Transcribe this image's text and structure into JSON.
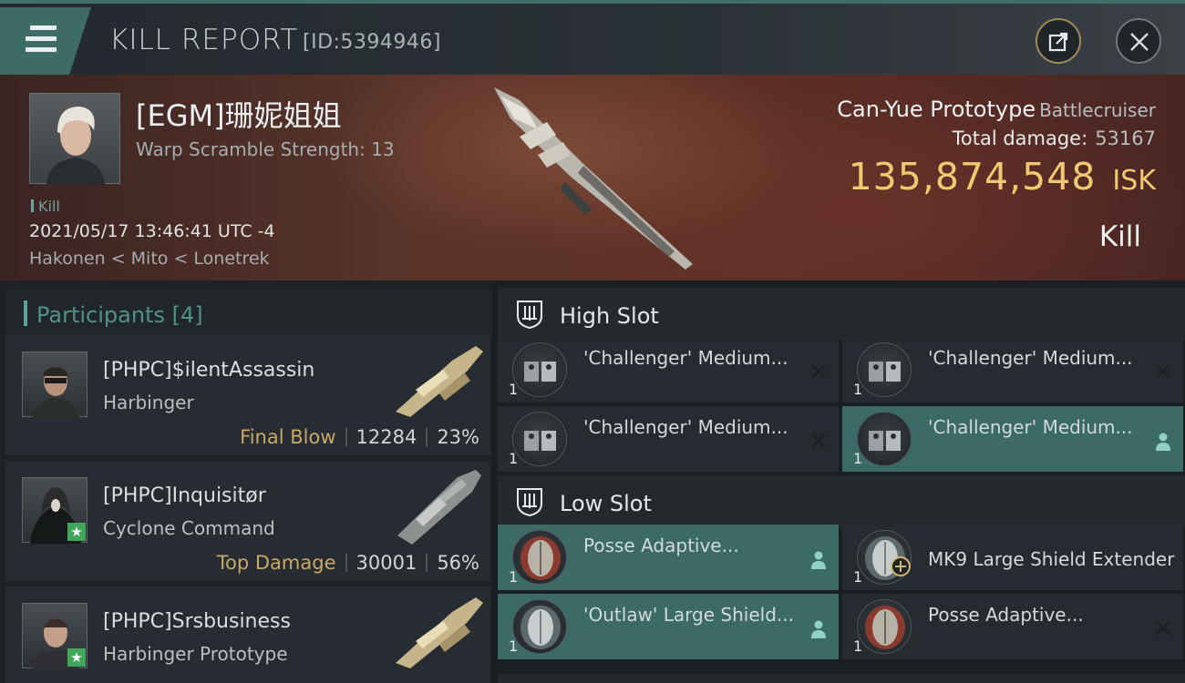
{
  "header": {
    "title": "KILL REPORT",
    "report_id": "[ID:5394946]",
    "share_icon": "share-icon",
    "close_icon": "close-icon"
  },
  "victim": {
    "name": "[EGM]珊妮姐姐",
    "warp_scramble": "Warp Scramble Strength: 13",
    "kill_tag": "Kill",
    "datetime": "2021/05/17 13:46:41 UTC -4",
    "location": "Hakonen < Mito < Lonetrek",
    "ship_name": "Can-Yue Prototype",
    "ship_class": "Battlecruiser",
    "total_damage_label": "Total damage:",
    "total_damage": "53167",
    "isk_value": "135,874,548",
    "isk_unit": "ISK",
    "result": "Kill"
  },
  "participants": {
    "label": "Participants",
    "count": "[4]",
    "items": [
      {
        "name": "[PHPC]$ilentAssassin",
        "ship": "Harbinger",
        "tag": "Final Blow",
        "damage": "12284",
        "percent": "23%"
      },
      {
        "name": "[PHPC]Inquisitør",
        "ship": "Cyclone Command",
        "tag": "Top Damage",
        "damage": "30001",
        "percent": "56%"
      },
      {
        "name": "[PHPC]Srsbusiness",
        "ship": "Harbinger Prototype"
      }
    ]
  },
  "fittings": {
    "high_slot": {
      "label": "High Slot",
      "modules": [
        {
          "name": "'Challenger' Medium...",
          "qty": "1"
        },
        {
          "name": "'Challenger' Medium...",
          "qty": "1"
        },
        {
          "name": "'Challenger' Medium...",
          "qty": "1"
        },
        {
          "name": "'Challenger' Medium...",
          "qty": "1"
        }
      ]
    },
    "low_slot": {
      "label": "Low Slot",
      "modules": [
        {
          "name": "Posse Adaptive...",
          "qty": "1"
        },
        {
          "name": "MK9 Large Shield Extender",
          "qty": "1"
        },
        {
          "name": "'Outlaw' Large Shield...",
          "qty": "1"
        },
        {
          "name": "Posse Adaptive...",
          "qty": "1"
        }
      ]
    }
  },
  "colors": {
    "accent_teal": "#3d6b66",
    "isk_gold": "#f2c873",
    "tag_gold": "#c8a96a",
    "participant_label": "#52918a"
  }
}
